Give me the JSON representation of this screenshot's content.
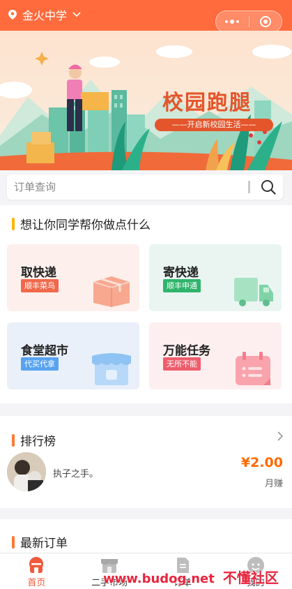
{
  "header": {
    "location": "金火中学"
  },
  "banner": {
    "title": "校园跑腿",
    "subtitle": "——开启新校园生活——"
  },
  "search": {
    "placeholder": "订单查询"
  },
  "services": {
    "title": "想让你同学帮你做点什么",
    "cards": [
      {
        "name": "取快递",
        "tag": "顺丰菜鸟",
        "tag_color": "#f0694c",
        "bg": "#fdf0ec",
        "icon": "package-box-icon"
      },
      {
        "name": "寄快递",
        "tag": "顺丰申通",
        "tag_color": "#2fb46c",
        "bg": "#eaf7f1",
        "icon": "delivery-truck-icon"
      },
      {
        "name": "食堂超市",
        "tag": "代买代拿",
        "tag_color": "#57a3f0",
        "bg": "#e9f1fb",
        "icon": "store-icon"
      },
      {
        "name": "万能任务",
        "tag": "无所不能",
        "tag_color": "#ef5d6c",
        "bg": "#fdeff0",
        "icon": "calendar-task-icon"
      }
    ]
  },
  "ranking": {
    "title": "排行榜",
    "entries": [
      {
        "name": "执子之手。",
        "amount": "¥2.00",
        "amount_label": "月赚"
      }
    ]
  },
  "latest_orders": {
    "title": "最新订单"
  },
  "tabbar": {
    "tabs": [
      {
        "label": "首页",
        "icon": "home-icon",
        "active": true
      },
      {
        "label": "二手市场",
        "icon": "market-icon",
        "active": false
      },
      {
        "label": "订单",
        "icon": "order-document-icon",
        "active": false
      },
      {
        "label": "我的",
        "icon": "profile-icon",
        "active": false
      }
    ]
  },
  "watermark": {
    "url": "www.budog.net",
    "text": "不懂社区"
  },
  "colors": {
    "primary": "#ff6b3d",
    "price": "#ff6a00",
    "tab_active": "#f05a3c"
  }
}
